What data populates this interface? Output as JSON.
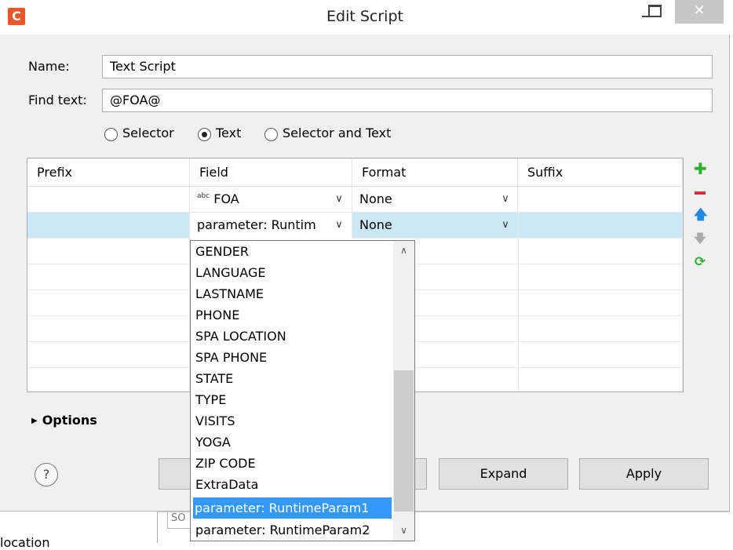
{
  "window": {
    "title": "Edit Script",
    "app_icon": "C",
    "close_glyph": "✕"
  },
  "form": {
    "name_label": "Name:",
    "name_value": "Text Script",
    "find_label": "Find text:",
    "find_value": "@FOA@",
    "radios": [
      {
        "label": "Selector",
        "selected": false
      },
      {
        "label": "Text",
        "selected": true
      },
      {
        "label": "Selector and Text",
        "selected": false
      }
    ]
  },
  "table": {
    "headers": [
      "Prefix",
      "Field",
      "Format",
      "Suffix"
    ],
    "rows": [
      {
        "prefix": "",
        "field_icon": "abc",
        "field": "FOA",
        "format": "None",
        "suffix": ""
      },
      {
        "prefix": "",
        "field": "parameter: Runtim",
        "format": "None",
        "suffix": ""
      }
    ]
  },
  "side_icons": [
    "add-icon",
    "remove-icon",
    "move-up-icon",
    "move-down-icon",
    "refresh-icon"
  ],
  "options_label": "Options",
  "buttons": {
    "help": "?",
    "expand": "Expand",
    "apply": "Apply"
  },
  "dropdown": {
    "items": [
      "GENDER",
      "LANGUAGE",
      "LASTNAME",
      "PHONE",
      "SPA LOCATION",
      "SPA PHONE",
      "STATE",
      "TYPE",
      "VISITS",
      "YOGA",
      "ZIP CODE",
      "ExtraData",
      "parameter: RuntimeParam1",
      "parameter: RuntimeParam2"
    ],
    "selected": "parameter: RuntimeParam1"
  },
  "background": {
    "partial_text": "location",
    "partial_tab": "SO"
  },
  "colors": {
    "accent": "#e8572a",
    "selected_row": "#cce8f6",
    "selection": "#3399ff",
    "add": "#2eae2e",
    "remove": "#d13438",
    "up": "#1e88e5"
  }
}
